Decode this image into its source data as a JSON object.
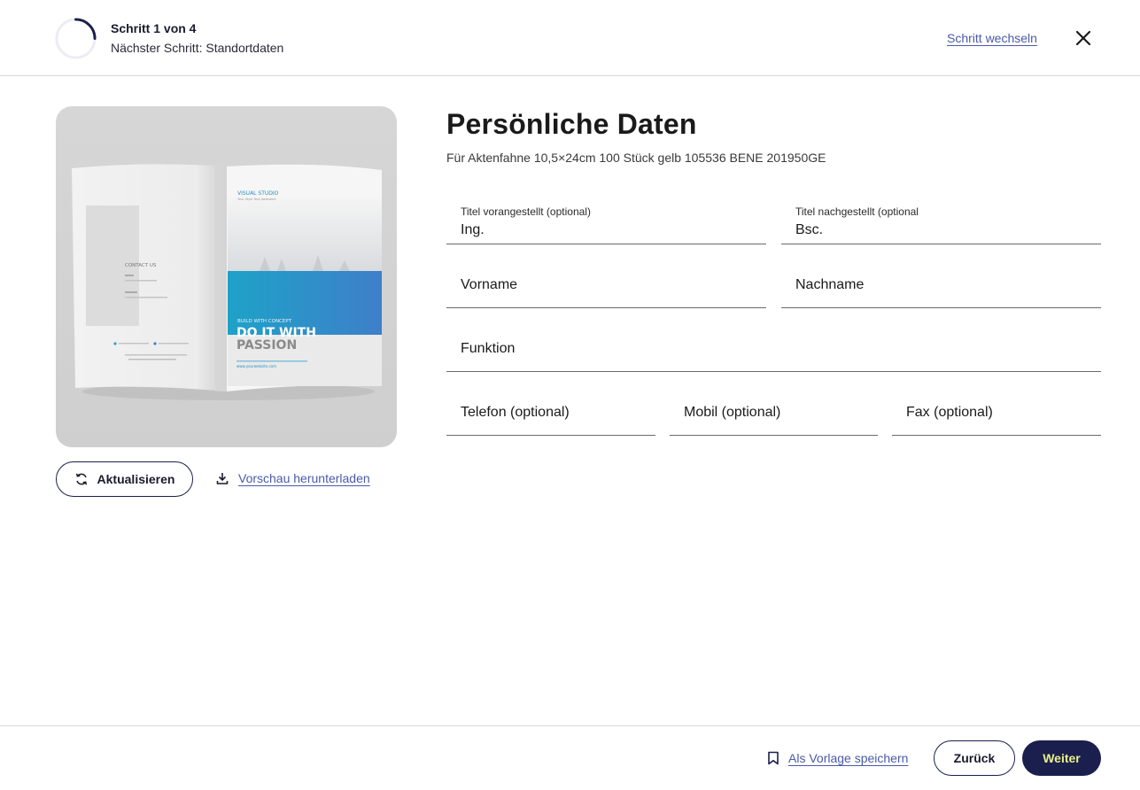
{
  "header": {
    "step_title": "Schritt 1 von 4",
    "next_step": "Nächster Schritt: Standortdaten",
    "step_progress": 0.25,
    "switch_step_label": "Schritt wechseln",
    "close_icon": "close-icon"
  },
  "preview": {
    "brochure_text": {
      "brand": "VISUAL STUDIO",
      "brand_sub": "Your Style Text Awesome",
      "contact": "CONTACT US",
      "tagline_small": "BUILD WITH CONCEPT",
      "headline_1": "DO IT WITH",
      "headline_2": "PASSION",
      "url": "www.yourwebsite.com"
    },
    "refresh_label": "Aktualisieren",
    "refresh_icon": "refresh-icon",
    "download_label": "Vorschau herunterladen",
    "download_icon": "download-icon"
  },
  "form": {
    "title": "Persönliche Daten",
    "subtitle": "Für Aktenfahne 10,5×24cm 100 Stück gelb 105536 BENE 201950GE",
    "fields": {
      "title_prefix": {
        "label": "Titel vorangestellt (optional)",
        "value": "Ing."
      },
      "title_suffix": {
        "label": "Titel nachgestellt (optional",
        "value": "Bsc."
      },
      "first_name": {
        "placeholder": "Vorname"
      },
      "last_name": {
        "placeholder": "Nachname"
      },
      "function": {
        "placeholder": "Funktion"
      },
      "phone": {
        "placeholder": "Telefon (optional)"
      },
      "mobile": {
        "placeholder": "Mobil (optional)"
      },
      "fax": {
        "placeholder": "Fax (optional)"
      }
    }
  },
  "footer": {
    "save_template_label": "Als Vorlage speichern",
    "save_template_icon": "bookmark-icon",
    "back_label": "Zurück",
    "next_label": "Weiter"
  },
  "colors": {
    "primary": "#1a1f4d",
    "link": "#4a5aa8",
    "next_text": "#e8f08a",
    "brochure_accent": "#2a8fc0"
  }
}
